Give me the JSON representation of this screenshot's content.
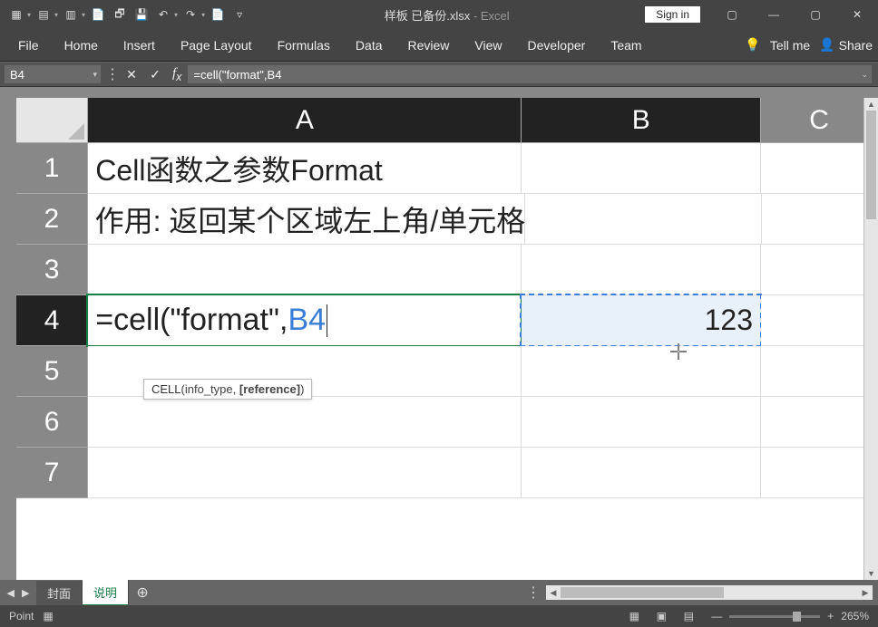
{
  "titlebar": {
    "filename": "样板 已备份.xlsx",
    "app": "Excel",
    "signin": "Sign in"
  },
  "ribbon": {
    "tabs": [
      "File",
      "Home",
      "Insert",
      "Page Layout",
      "Formulas",
      "Data",
      "Review",
      "View",
      "Developer",
      "Team"
    ],
    "tellme": "Tell me",
    "share": "Share"
  },
  "fxbar": {
    "namebox": "B4",
    "formula": "=cell(\"format\",B4"
  },
  "columns": [
    "A",
    "B",
    "C"
  ],
  "rows": [
    "1",
    "2",
    "3",
    "4",
    "5",
    "6",
    "7"
  ],
  "cells": {
    "A1": "Cell函数之参数Format",
    "A2": "作用: 返回某个区域左上角/单元格格式",
    "A4_prefix": "=cell(\"format\",",
    "A4_ref": "B4",
    "B4": "123"
  },
  "tooltip": {
    "fn": "CELL",
    "args_plain": "(info_type, ",
    "args_bold": "[reference]",
    "args_close": ")"
  },
  "sheettabs": {
    "tabs": [
      "封面",
      "说明"
    ],
    "active": 1
  },
  "statusbar": {
    "mode": "Point",
    "zoom": "265%"
  }
}
